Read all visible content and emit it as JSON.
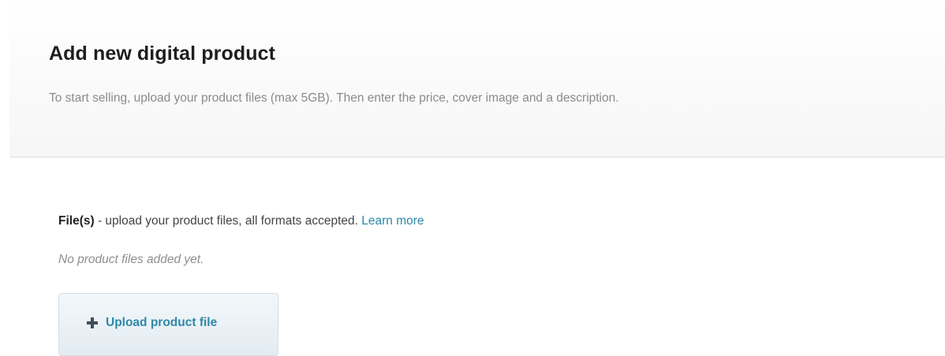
{
  "header": {
    "title": "Add new digital product",
    "subtitle": "To start selling, upload your product files (max 5GB). Then enter the price, cover image and a description."
  },
  "files": {
    "label": "File(s)",
    "description": " - upload your product files, all formats accepted. ",
    "learn_more": "Learn more",
    "empty_message": "No product files added yet.",
    "upload_button": {
      "icon": "plus-icon",
      "label": "Upload product file"
    }
  }
}
